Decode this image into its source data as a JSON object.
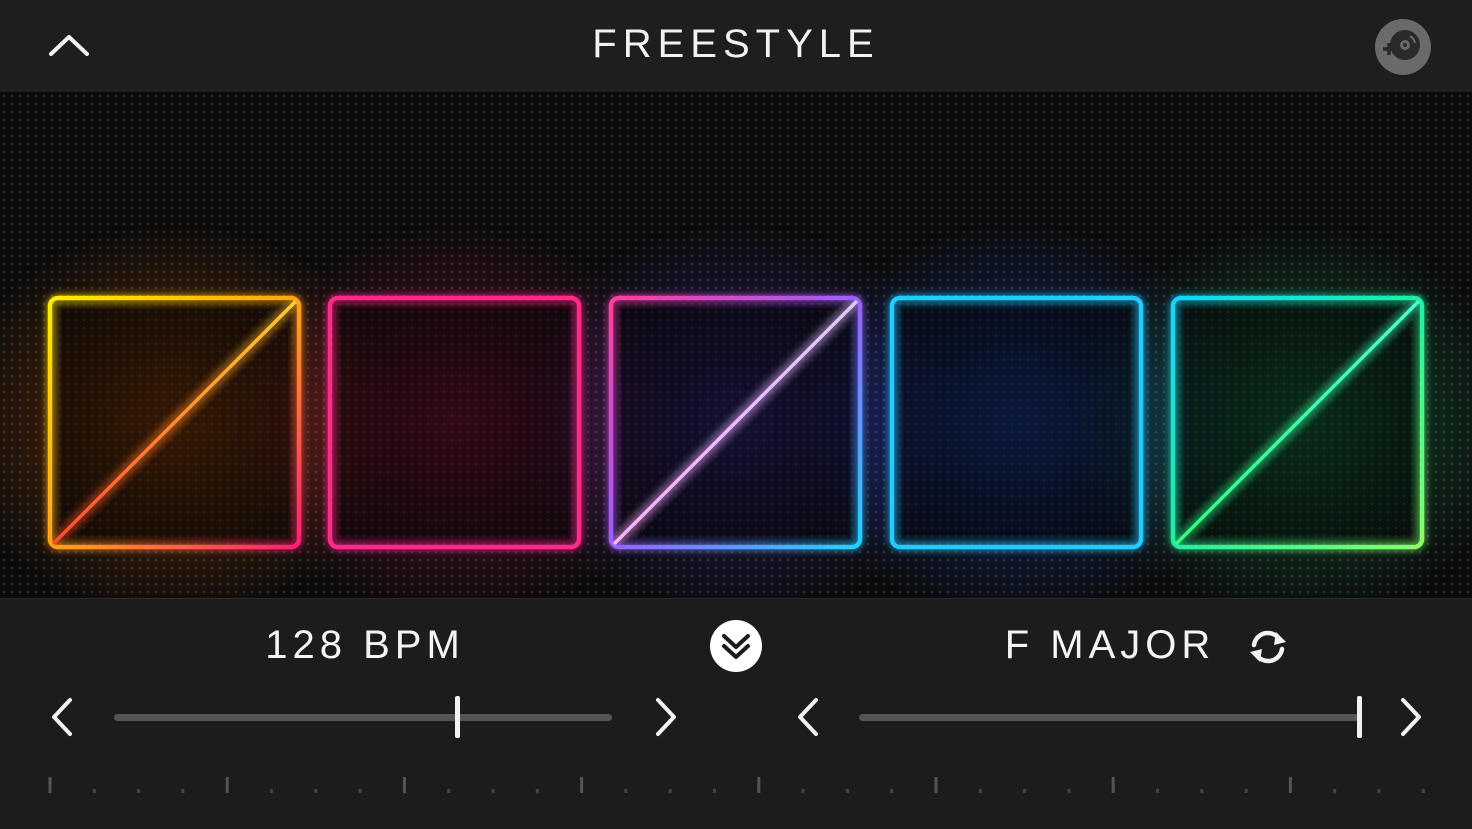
{
  "header": {
    "title": "FREESTYLE",
    "collapse_icon": "chevron-up-icon",
    "record_icon": "vinyl-add-icon"
  },
  "pads": [
    {
      "id": "pad-1",
      "diagonal": true,
      "color_start": "#ffee00",
      "color_end": "#ff1e78",
      "glow": "#ff6a00"
    },
    {
      "id": "pad-2",
      "diagonal": false,
      "color_start": "#ff2a8a",
      "color_end": "#ff2a8a",
      "glow": "#ff1a6a"
    },
    {
      "id": "pad-3",
      "diagonal": true,
      "color_start": "#ff3fa0",
      "color_end": "#22d2ff",
      "glow": "#5a40ff"
    },
    {
      "id": "pad-4",
      "diagonal": false,
      "color_start": "#22ccff",
      "color_end": "#22ccff",
      "glow": "#1a5aff"
    },
    {
      "id": "pad-5",
      "diagonal": true,
      "color_start": "#18d4ff",
      "color_end": "#8aff6a",
      "glow": "#22ff88"
    }
  ],
  "tempo": {
    "label": "128 BPM",
    "slider_value": 0.69
  },
  "key": {
    "label": "F MAJOR",
    "slider_value": 1.0,
    "refresh_icon": "refresh-icon"
  },
  "expand_icon": "double-chevron-down-icon",
  "colors": {
    "background": "#1c1c1c",
    "pad_bg": "#0a0a0a",
    "track": "#555555",
    "text": "#f4f4f4"
  }
}
